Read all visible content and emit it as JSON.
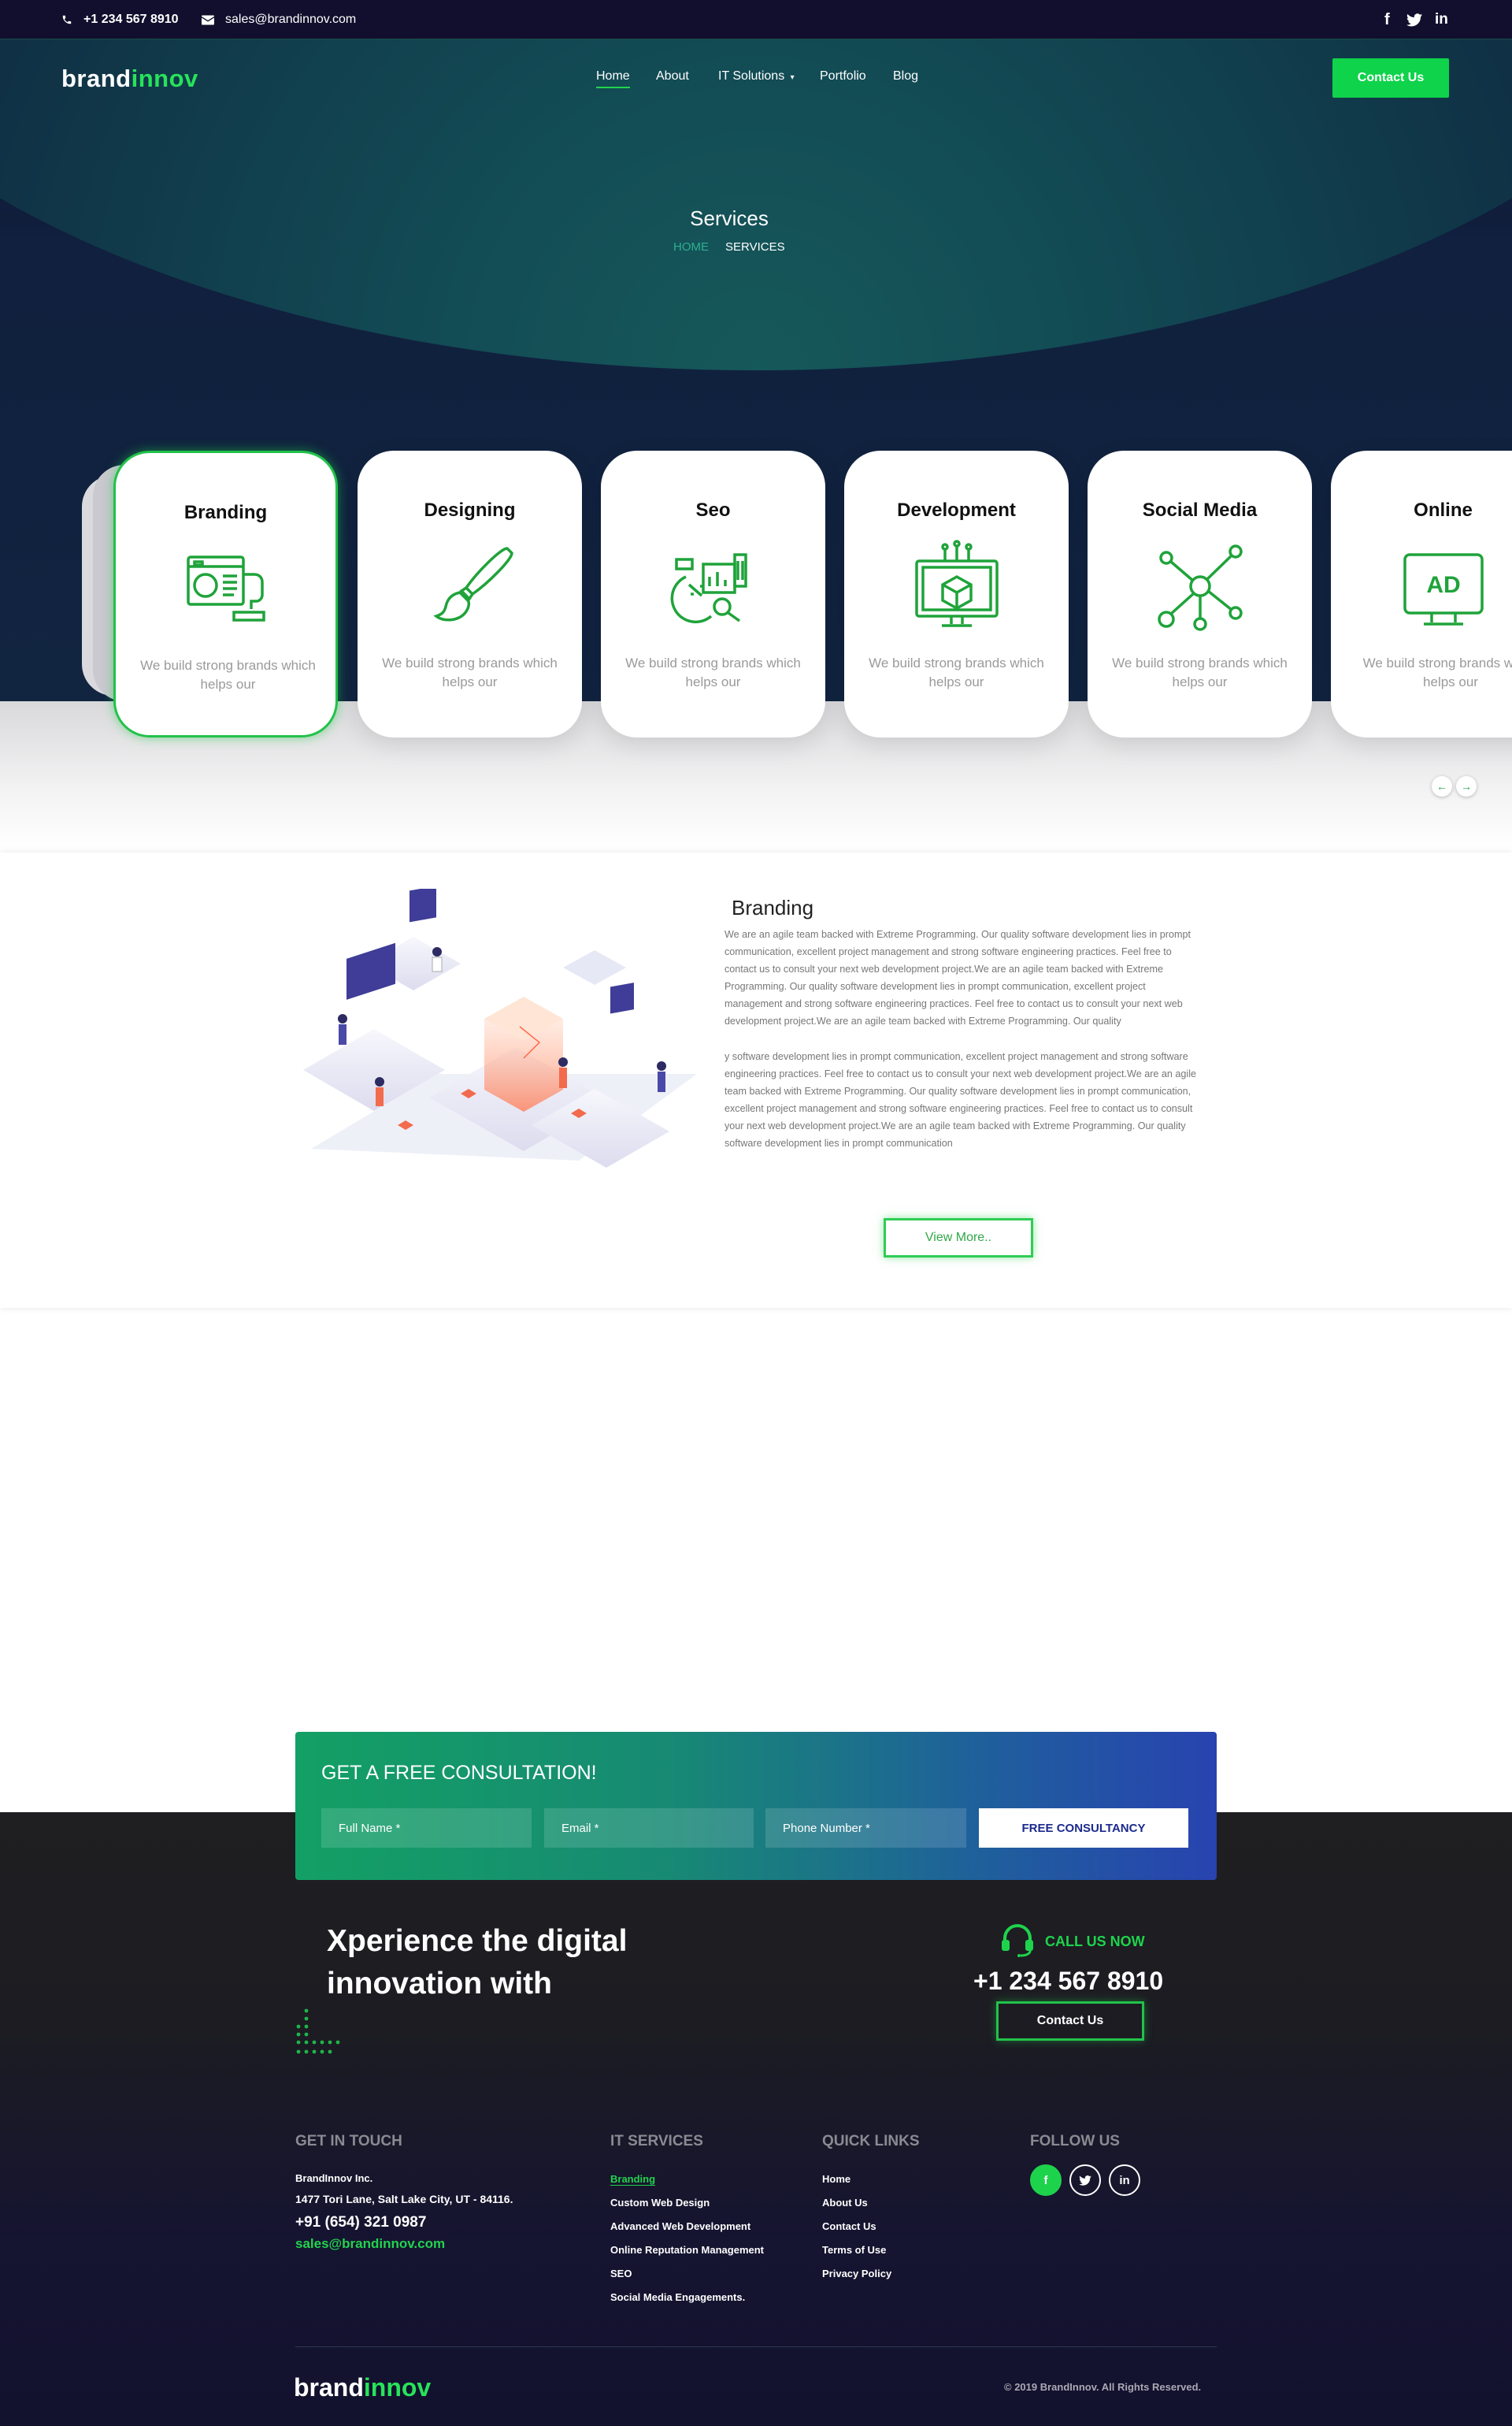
{
  "topbar": {
    "phone": "+1 234 567 8910",
    "email": "sales@brandinnov.com",
    "social": [
      "f",
      "t",
      "in"
    ]
  },
  "header": {
    "logo_part1": "brand",
    "logo_part2": "innov",
    "nav": [
      "Home",
      "About",
      "IT Solutions",
      "Portfolio",
      "Blog"
    ],
    "nav_active": "Home",
    "contact_label": "Contact Us"
  },
  "hero": {
    "title": "Services",
    "breadcrumb_home": "HOME",
    "breadcrumb_current": "SERVICES"
  },
  "services": [
    {
      "title": "Branding",
      "desc": "We build strong brands which helps our",
      "icon": "branding-icon"
    },
    {
      "title": "Designing",
      "desc": "We build strong brands which helps our",
      "icon": "paintbrush-icon"
    },
    {
      "title": "Seo",
      "desc": "We build strong brands which helps our",
      "icon": "seo-chart-icon"
    },
    {
      "title": "Development",
      "desc": "We build strong brands which helps our",
      "icon": "monitor-cube-icon"
    },
    {
      "title": "Social Media",
      "desc": "We build strong brands which helps our",
      "icon": "network-icon"
    },
    {
      "title": "Online",
      "desc": "We build strong brands which helps our",
      "icon": "ad-monitor-icon"
    }
  ],
  "branding": {
    "title": "Branding",
    "para1": "We are an agile team backed with Extreme Programming. Our quality software development lies in prompt communication, excellent project management and strong software engineering practices. Feel free to contact us to consult your next web development project.We are an agile team backed with Extreme Programming. Our quality software development lies in prompt communication, excellent project management and strong software engineering practices. Feel free to contact us to consult your next web development project.We are an agile team backed with Extreme Programming. Our quality",
    "para2": "y software development lies in prompt communication, excellent project management and strong software engineering practices. Feel free to contact us to consult your next web development project.We are an agile team backed with Extreme Programming. Our quality software development lies in prompt communication, excellent project management and strong software engineering practices. Feel free to contact us to consult your next web development project.We are an agile team backed with Extreme Programming. Our quality software development lies in prompt communication",
    "view_more": "View More.."
  },
  "consultation": {
    "title": "GET A FREE CONSULTATION!",
    "fullname_placeholder": "Full Name *",
    "email_placeholder": "Email *",
    "phone_placeholder": "Phone Number *",
    "button": "FREE CONSULTANCY"
  },
  "cta": {
    "line1": "Xperience the digital",
    "line2": "innovation with",
    "call_label": "CALL US NOW",
    "call_number": "+1 234 567 8910",
    "contact_button": "Contact Us"
  },
  "footer": {
    "touch_heading": "GET IN TOUCH",
    "company": "BrandInnov Inc.",
    "address": "1477  Tori Lane, Salt Lake City, UT - 84116.",
    "phone": "+91 (654) 321 0987",
    "email": "sales@brandinnov.com",
    "services_heading": "IT SERVICES",
    "services": [
      "Branding",
      "Custom Web Design",
      "Advanced Web Development",
      "Online Reputation Management",
      "SEO",
      "Social Media Engagements."
    ],
    "links_heading": "QUICK LINKS",
    "links": [
      "Home",
      "About Us",
      "Contact Us",
      "Terms of Use",
      "Privacy Policy"
    ],
    "follow_heading": "FOLLOW US",
    "social": [
      "f",
      "t",
      "in"
    ],
    "logo_part1": "brand",
    "logo_part2": "innov",
    "copyright": "© 2019  BrandInnov. All Rights Reserved."
  },
  "colors": {
    "accent": "#22d34d",
    "dark": "#110f2d",
    "card_active_border": "#22c24a"
  }
}
